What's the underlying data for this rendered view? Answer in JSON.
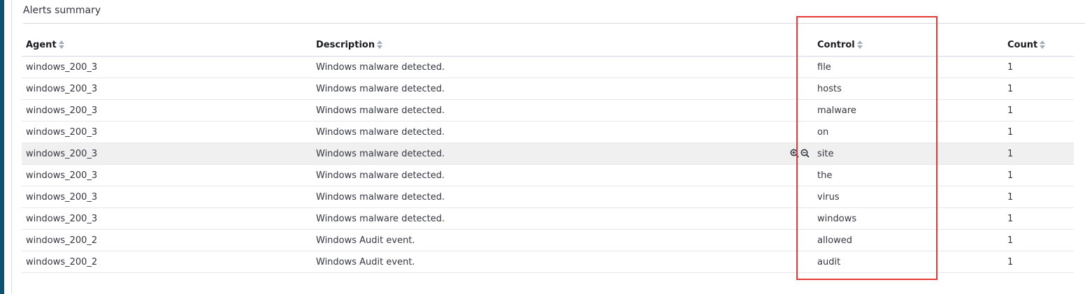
{
  "panel": {
    "title": "Alerts summary"
  },
  "table": {
    "columns": [
      {
        "key": "agent",
        "label": "Agent"
      },
      {
        "key": "description",
        "label": "Description"
      },
      {
        "key": "control",
        "label": "Control"
      },
      {
        "key": "count",
        "label": "Count"
      }
    ],
    "rows": [
      {
        "agent": "windows_200_3",
        "description": "Windows malware detected.",
        "control": "file",
        "count": "1"
      },
      {
        "agent": "windows_200_3",
        "description": "Windows malware detected.",
        "control": "hosts",
        "count": "1"
      },
      {
        "agent": "windows_200_3",
        "description": "Windows malware detected.",
        "control": "malware",
        "count": "1"
      },
      {
        "agent": "windows_200_3",
        "description": "Windows malware detected.",
        "control": "on",
        "count": "1"
      },
      {
        "agent": "windows_200_3",
        "description": "Windows malware detected.",
        "control": "site",
        "count": "1"
      },
      {
        "agent": "windows_200_3",
        "description": "Windows malware detected.",
        "control": "the",
        "count": "1"
      },
      {
        "agent": "windows_200_3",
        "description": "Windows malware detected.",
        "control": "virus",
        "count": "1"
      },
      {
        "agent": "windows_200_3",
        "description": "Windows malware detected.",
        "control": "windows",
        "count": "1"
      },
      {
        "agent": "windows_200_2",
        "description": "Windows Audit event.",
        "control": "allowed",
        "count": "1"
      },
      {
        "agent": "windows_200_2",
        "description": "Windows Audit event.",
        "control": "audit",
        "count": "1"
      }
    ],
    "hovered_row": 4
  },
  "icons": {
    "sort": "sort-icon",
    "filter_in": "zoom-in-icon",
    "filter_out": "zoom-out-icon"
  },
  "colors": {
    "accent_bar": "#0e5273",
    "highlight": "#e53935",
    "hover_row": "#f0f0f0"
  }
}
